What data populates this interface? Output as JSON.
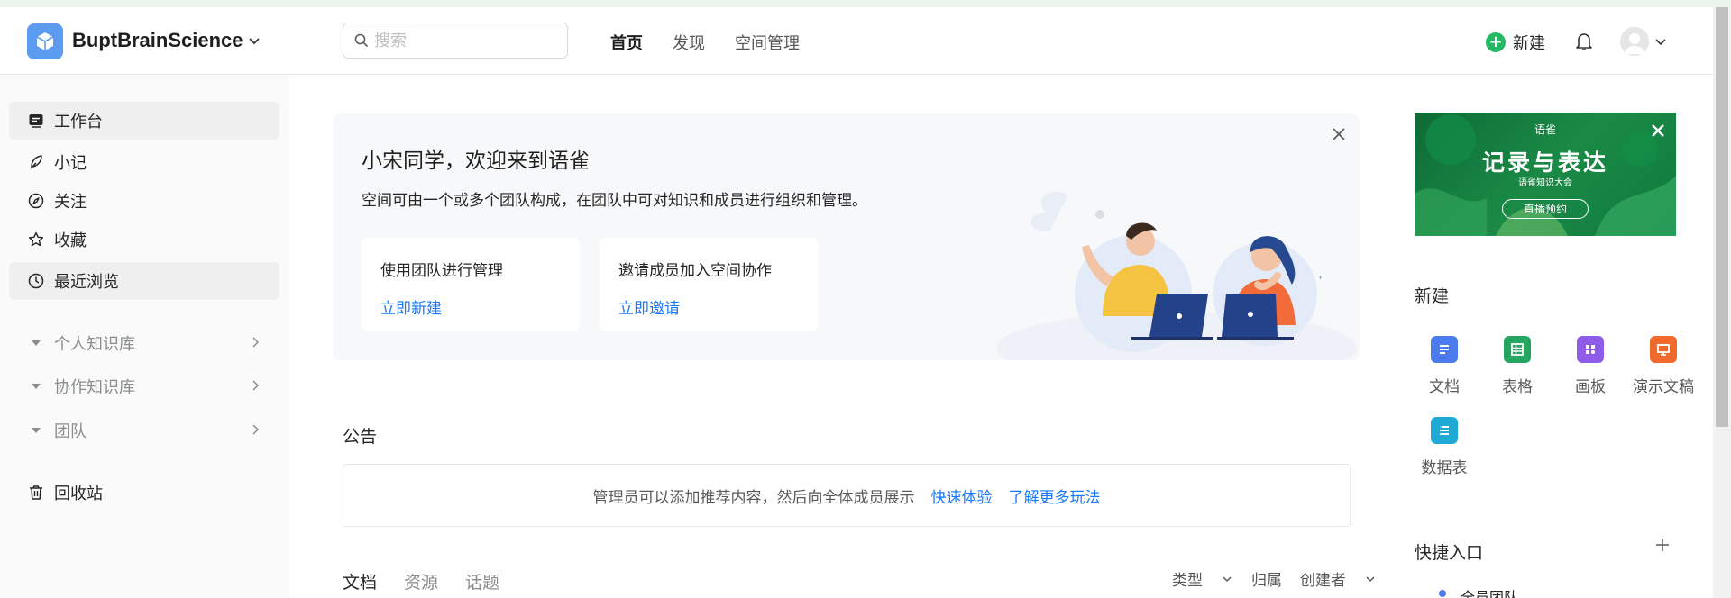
{
  "header": {
    "org_name": "BuptBrainScience",
    "search_placeholder": "搜索",
    "nav": [
      "首页",
      "发现",
      "空间管理"
    ],
    "new_label": "新建"
  },
  "sidebar": {
    "items": [
      {
        "label": "工作台",
        "icon": "workbench-icon",
        "selected": true
      },
      {
        "label": "小记",
        "icon": "feather-icon"
      },
      {
        "label": "关注",
        "icon": "compass-icon"
      },
      {
        "label": "收藏",
        "icon": "star-icon"
      },
      {
        "label": "最近浏览",
        "icon": "clock-icon",
        "selected": true
      }
    ],
    "groups": [
      "个人知识库",
      "协作知识库",
      "团队"
    ],
    "trash": "回收站"
  },
  "welcome": {
    "title": "小宋同学，欢迎来到语雀",
    "subtitle": "空间可由一个或多个团队构成，在团队中可对知识和成员进行组织和管理。",
    "cards": [
      {
        "title": "使用团队进行管理",
        "link": "立即新建"
      },
      {
        "title": "邀请成员加入空间协作",
        "link": "立即邀请"
      }
    ]
  },
  "notice": {
    "label": "公告",
    "text": "管理员可以添加推荐内容，然后向全体成员展示",
    "link1": "快速体验",
    "link2": "了解更多玩法"
  },
  "tabs": [
    "文档",
    "资源",
    "话题"
  ],
  "filters": {
    "type": "类型",
    "belong": "归属",
    "creator": "创建者"
  },
  "banner": {
    "brand": "语雀",
    "title": "记录与表达",
    "subtitle": "语雀知识大会",
    "button": "直播预约"
  },
  "create": {
    "title": "新建",
    "items": [
      {
        "label": "文档",
        "icon": "doc-icon",
        "color": "#4b7bec"
      },
      {
        "label": "表格",
        "icon": "sheet-icon",
        "color": "#25a55f"
      },
      {
        "label": "画板",
        "icon": "board-icon",
        "color": "#8e5ce6"
      },
      {
        "label": "演示文稿",
        "icon": "slides-icon",
        "color": "#f06a2b"
      },
      {
        "label": "数据表",
        "icon": "datatable-icon",
        "color": "#1faad6"
      }
    ]
  },
  "quick": {
    "title": "快捷入口",
    "first_item": "全员团队"
  },
  "colors": {
    "accent": "#1677ff",
    "green": "#25b864"
  }
}
